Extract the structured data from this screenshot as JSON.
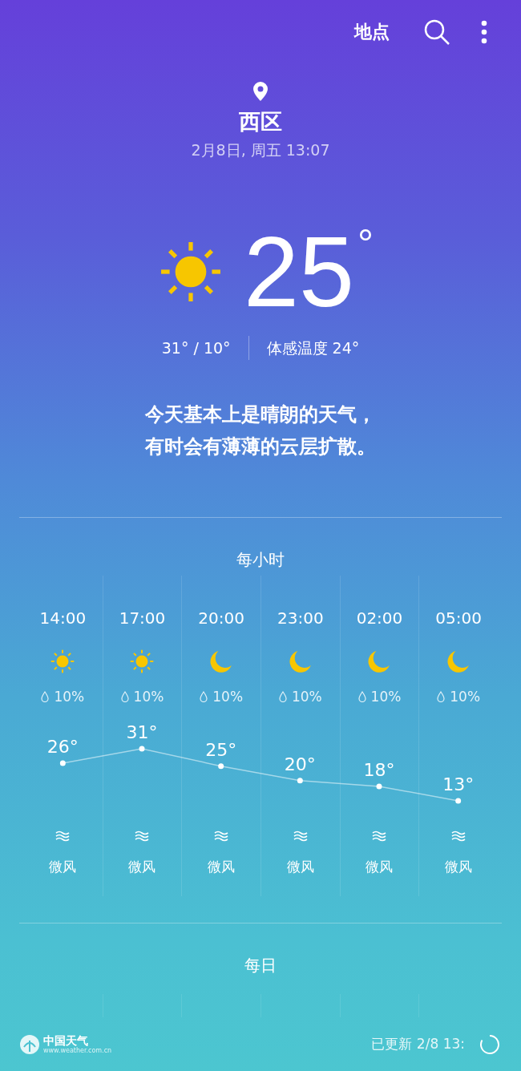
{
  "toolbar": {
    "locations_label": "地点"
  },
  "location": {
    "name": "西区",
    "datetime": "2月8日, 周五 13:07"
  },
  "current": {
    "kind": "sunny",
    "temp": "25",
    "unit": "°",
    "hilo": "31° / 10°",
    "feels_like": "体感温度 24°"
  },
  "description": [
    "今天基本上是晴朗的天气，",
    "有时会有薄薄的云层扩散。"
  ],
  "hourly": {
    "title": "每小时",
    "hours": [
      {
        "kind": "sunny",
        "precip": "10%",
        "wind": "微风"
      },
      {
        "kind": "sunny",
        "precip": "10%",
        "wind": "微风"
      },
      {
        "kind": "moon",
        "precip": "10%",
        "wind": "微风"
      },
      {
        "kind": "moon",
        "precip": "10%",
        "wind": "微风"
      },
      {
        "kind": "moon",
        "precip": "10%",
        "wind": "微风"
      },
      {
        "kind": "moon",
        "precip": "10%",
        "wind": "微风"
      }
    ],
    "chart_data": {
      "type": "line",
      "categories": [
        "14:00",
        "17:00",
        "20:00",
        "23:00",
        "02:00",
        "05:00"
      ],
      "values": [
        26,
        31,
        25,
        20,
        18,
        13
      ],
      "marker": "circle",
      "value_labels": [
        "26°",
        "31°",
        "25°",
        "20°",
        "18°",
        "13°"
      ]
    }
  },
  "daily": {
    "title": "每日"
  },
  "footer": {
    "provider": "中国天气",
    "provider_url": "www.weather.com.cn",
    "updated": "已更新 2/8 13:"
  }
}
